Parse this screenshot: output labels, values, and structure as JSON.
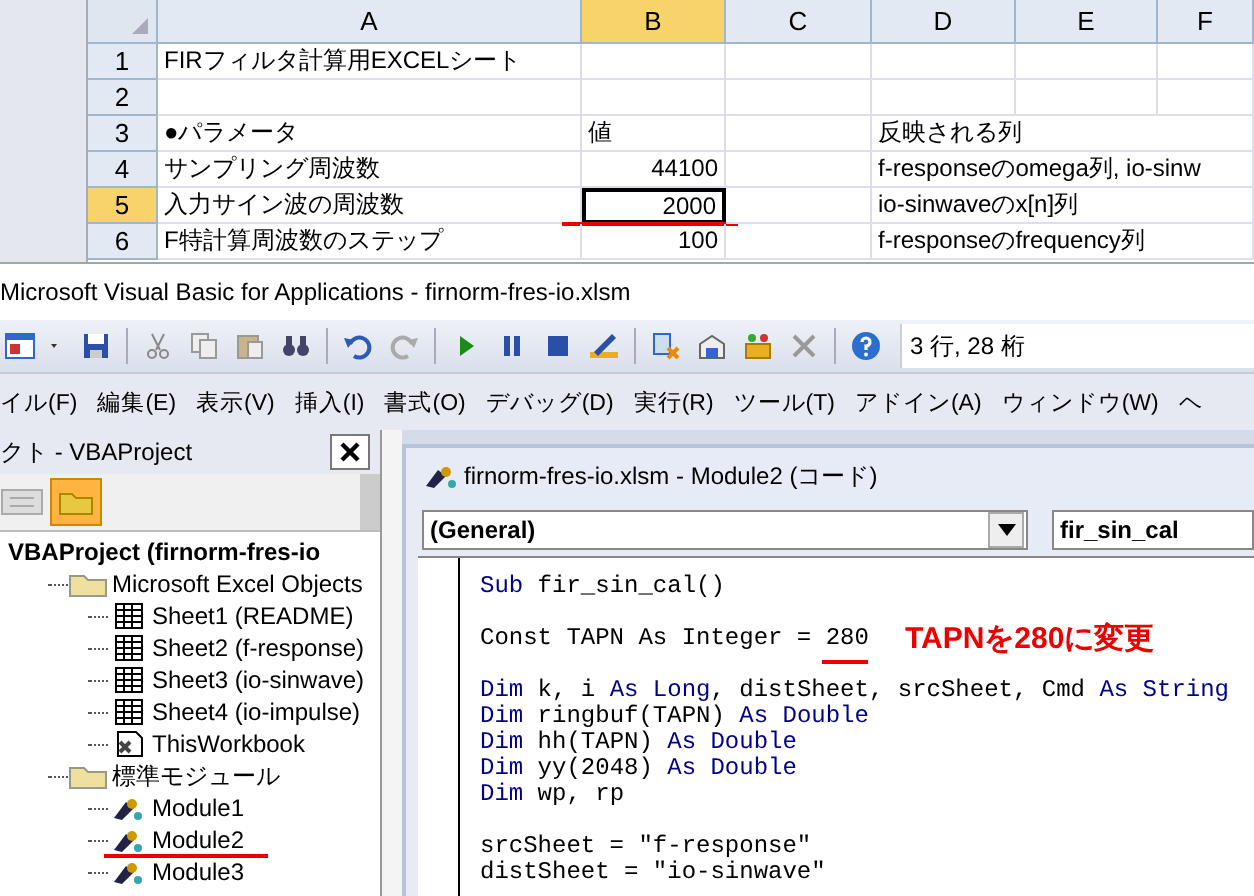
{
  "sheet": {
    "columns": [
      {
        "label": "A",
        "selected": false
      },
      {
        "label": "B",
        "selected": true
      },
      {
        "label": "C",
        "selected": false
      },
      {
        "label": "D",
        "selected": false
      },
      {
        "label": "E",
        "selected": false
      },
      {
        "label": "F",
        "selected": false
      }
    ],
    "rows": [
      {
        "label": "1",
        "selected": false,
        "cells": [
          {
            "kind": "text",
            "text": "FIRフィルタ計算用EXCELシート"
          },
          {
            "kind": "empty"
          },
          {
            "kind": "empty"
          },
          {
            "kind": "empty"
          }
        ]
      },
      {
        "label": "2",
        "selected": false,
        "cells": [
          {
            "kind": "empty"
          },
          {
            "kind": "empty"
          },
          {
            "kind": "empty"
          },
          {
            "kind": "empty"
          }
        ]
      },
      {
        "label": "3",
        "selected": false,
        "cells": [
          {
            "kind": "text",
            "text": "●パラメータ"
          },
          {
            "kind": "text",
            "text": "値"
          },
          {
            "kind": "empty"
          },
          {
            "kind": "text",
            "text": "反映される列"
          }
        ]
      },
      {
        "label": "4",
        "selected": false,
        "cells": [
          {
            "kind": "text",
            "text": "サンプリング周波数"
          },
          {
            "kind": "number",
            "text": "44100"
          },
          {
            "kind": "empty"
          },
          {
            "kind": "text",
            "text": "f-responseのomega列, io-sinw"
          }
        ]
      },
      {
        "label": "5",
        "selected": true,
        "cells": [
          {
            "kind": "text",
            "text": "入力サイン波の周波数"
          },
          {
            "kind": "number",
            "text": "2000",
            "selected": true,
            "underlined": true
          },
          {
            "kind": "empty"
          },
          {
            "kind": "text",
            "text": "io-sinwaveのx[n]列"
          }
        ]
      },
      {
        "label": "6",
        "selected": false,
        "cells": [
          {
            "kind": "text",
            "text": "F特計算周波数のステップ"
          },
          {
            "kind": "number",
            "text": "100"
          },
          {
            "kind": "empty"
          },
          {
            "kind": "text",
            "text": "f-responseのfrequency列"
          }
        ]
      }
    ]
  },
  "window": {
    "title": "Microsoft Visual Basic for Applications - firnorm-fres-io.xlsm"
  },
  "toolbar": {
    "position": "3 行, 28 桁"
  },
  "menu": [
    "イル(F)",
    "編集(E)",
    "表示(V)",
    "挿入(I)",
    "書式(O)",
    "デバッグ(D)",
    "実行(R)",
    "ツール(T)",
    "アドイン(A)",
    "ウィンドウ(W)",
    "ヘ"
  ],
  "project_panel": {
    "title": "クト - VBAProject",
    "toggle_folders": {
      "selected": true
    },
    "tree": {
      "label": "VBAProject (firnorm-fres-io",
      "kind": "project",
      "children": [
        {
          "label": "Microsoft Excel Objects",
          "kind": "folder",
          "children": [
            {
              "label": "Sheet1 (README)",
              "kind": "sheet",
              "underlined": false
            },
            {
              "label": "Sheet2 (f-response)",
              "kind": "sheet",
              "underlined": false
            },
            {
              "label": "Sheet3 (io-sinwave)",
              "kind": "sheet",
              "underlined": false
            },
            {
              "label": "Sheet4 (io-impulse)",
              "kind": "sheet",
              "underlined": false
            },
            {
              "label": "ThisWorkbook",
              "kind": "workbook",
              "underlined": false
            }
          ]
        },
        {
          "label": "標準モジュール",
          "kind": "folder",
          "children": [
            {
              "label": "Module1",
              "kind": "module",
              "underlined": false
            },
            {
              "label": "Module2",
              "kind": "module",
              "underlined": true
            },
            {
              "label": "Module3",
              "kind": "module",
              "underlined": false
            }
          ]
        }
      ]
    }
  },
  "code_window": {
    "title": "firnorm-fres-io.xlsm - Module2 (コード)",
    "object": "(General)",
    "procedure": "fir_sin_cal",
    "lines": [
      {
        "kind": "code",
        "tokens": [
          {
            "kind": "keyword",
            "text": "Sub"
          },
          {
            "kind": "plain",
            "text": " fir_sin_cal()"
          }
        ]
      },
      {
        "kind": "blank"
      },
      {
        "kind": "code",
        "tokens": [
          {
            "kind": "plain",
            "text": "Const TAPN As Integer = "
          },
          {
            "kind": "plain",
            "text": "280",
            "underlined": true
          }
        ],
        "note": "TAPNを280に変更"
      },
      {
        "kind": "blank"
      },
      {
        "kind": "code",
        "tokens": [
          {
            "kind": "keyword",
            "text": "Dim"
          },
          {
            "kind": "plain",
            "text": " k, i "
          },
          {
            "kind": "keyword",
            "text": "As Long"
          },
          {
            "kind": "plain",
            "text": ", distSheet, srcSheet, Cmd "
          },
          {
            "kind": "keyword",
            "text": "As String"
          }
        ]
      },
      {
        "kind": "code",
        "tokens": [
          {
            "kind": "keyword",
            "text": "Dim"
          },
          {
            "kind": "plain",
            "text": " ringbuf(TAPN) "
          },
          {
            "kind": "keyword",
            "text": "As Double"
          }
        ]
      },
      {
        "kind": "code",
        "tokens": [
          {
            "kind": "keyword",
            "text": "Dim"
          },
          {
            "kind": "plain",
            "text": " hh(TAPN) "
          },
          {
            "kind": "keyword",
            "text": "As Double"
          }
        ]
      },
      {
        "kind": "code",
        "tokens": [
          {
            "kind": "keyword",
            "text": "Dim"
          },
          {
            "kind": "plain",
            "text": " yy(2048) "
          },
          {
            "kind": "keyword",
            "text": "As Double"
          }
        ]
      },
      {
        "kind": "code",
        "tokens": [
          {
            "kind": "keyword",
            "text": "Dim"
          },
          {
            "kind": "plain",
            "text": " wp, rp"
          }
        ]
      },
      {
        "kind": "blank"
      },
      {
        "kind": "code",
        "tokens": [
          {
            "kind": "plain",
            "text": "srcSheet = \"f-response\""
          }
        ]
      },
      {
        "kind": "code",
        "tokens": [
          {
            "kind": "plain",
            "text": "distSheet = \"io-sinwave\""
          }
        ]
      }
    ]
  }
}
